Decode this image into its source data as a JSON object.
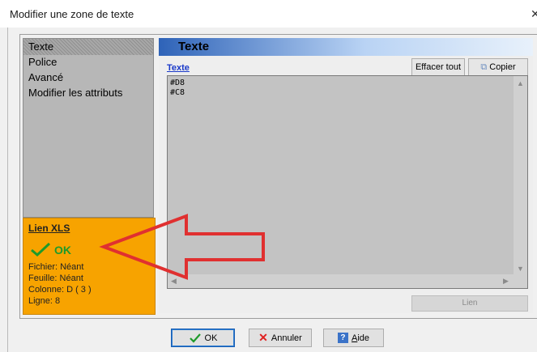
{
  "window": {
    "title": "Modifier une zone de texte"
  },
  "sidebar": {
    "items": [
      {
        "label": "Texte",
        "selected": true
      },
      {
        "label": "Police"
      },
      {
        "label": "Avancé"
      },
      {
        "label": "Modifier les attributs"
      }
    ]
  },
  "xls_link": {
    "title": "Lien XLS",
    "status": "OK",
    "fichier": "Fichier: Néant",
    "feuille": "Feuille: Néant",
    "colonne": "Colonne: D ( 3 )",
    "ligne": "Ligne: 8"
  },
  "panel": {
    "header": "Texte",
    "text_link": "Texte",
    "clear_button": "Effacer tout",
    "copy_button": "Copier",
    "editor_lines": [
      "#D8",
      "#C8"
    ],
    "lien_button": "Lien"
  },
  "footer": {
    "ok": "OK",
    "cancel": "Annuler",
    "help_pre": "",
    "help_ul": "A",
    "help_post": "ide"
  },
  "colors": {
    "accent": "#f7a300",
    "arrow": "#e03030",
    "ok_green": "#1e9a2a",
    "header_blue": "#2e63b8"
  }
}
